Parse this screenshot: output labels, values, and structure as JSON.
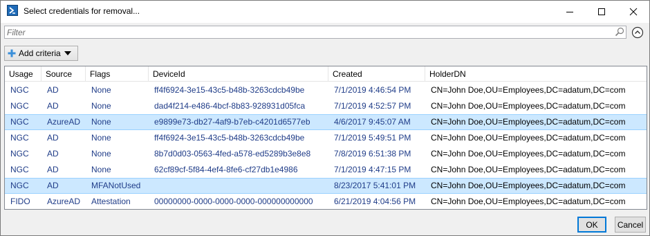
{
  "window": {
    "title": "Select credentials for removal...",
    "controls": [
      "minimize",
      "maximize",
      "close"
    ]
  },
  "filter": {
    "placeholder": "Filter",
    "value": ""
  },
  "toolbar": {
    "add_criteria_label": "Add criteria"
  },
  "grid": {
    "columns": [
      "Usage",
      "Source",
      "Flags",
      "DeviceId",
      "Created",
      "HolderDN"
    ],
    "rows": [
      {
        "usage": "NGC",
        "source": "AD",
        "flags": "None",
        "device_id": "ff4f6924-3e15-43c5-b48b-3263cdcb49be",
        "created": "7/1/2019 4:46:54 PM",
        "holder_dn": "CN=John Doe,OU=Employees,DC=adatum,DC=com",
        "selected": false
      },
      {
        "usage": "NGC",
        "source": "AD",
        "flags": "None",
        "device_id": "dad4f214-e486-4bcf-8b83-928931d05fca",
        "created": "7/1/2019 4:52:57 PM",
        "holder_dn": "CN=John Doe,OU=Employees,DC=adatum,DC=com",
        "selected": false
      },
      {
        "usage": "NGC",
        "source": "AzureAD",
        "flags": "None",
        "device_id": "e9899e73-db27-4af9-b7eb-c4201d6577eb",
        "created": "4/6/2017 9:45:07 AM",
        "holder_dn": "CN=John Doe,OU=Employees,DC=adatum,DC=com",
        "selected": true
      },
      {
        "usage": "NGC",
        "source": "AD",
        "flags": "None",
        "device_id": "ff4f6924-3e15-43c5-b48b-3263cdcb49be",
        "created": "7/1/2019 5:49:51 PM",
        "holder_dn": "CN=John Doe,OU=Employees,DC=adatum,DC=com",
        "selected": false
      },
      {
        "usage": "NGC",
        "source": "AD",
        "flags": "None",
        "device_id": "8b7d0d03-0563-4fed-a578-ed5289b3e8e8",
        "created": "7/8/2019 6:51:38 PM",
        "holder_dn": "CN=John Doe,OU=Employees,DC=adatum,DC=com",
        "selected": false
      },
      {
        "usage": "NGC",
        "source": "AD",
        "flags": "None",
        "device_id": "62cf89cf-5f84-4ef4-8fe6-cf27db1e4986",
        "created": "7/1/2019 4:47:15 PM",
        "holder_dn": "CN=John Doe,OU=Employees,DC=adatum,DC=com",
        "selected": false
      },
      {
        "usage": "NGC",
        "source": "AD",
        "flags": "MFANotUsed",
        "device_id": "",
        "created": "8/23/2017 5:41:01 PM",
        "holder_dn": "CN=John Doe,OU=Employees,DC=adatum,DC=com",
        "selected": true
      },
      {
        "usage": "FIDO",
        "source": "AzureAD",
        "flags": "Attestation",
        "device_id": "00000000-0000-0000-0000-000000000000",
        "created": "6/21/2019 4:04:56 PM",
        "holder_dn": "CN=John Doe,OU=Employees,DC=adatum,DC=com",
        "selected": false
      }
    ]
  },
  "buttons": {
    "ok_label": "OK",
    "cancel_label": "Cancel"
  },
  "colors": {
    "selection_bg": "#cce8ff",
    "selection_border": "#99d1ff",
    "cell_text": "#1f3c88",
    "default_button_border": "#0078d7"
  },
  "icons": {
    "app": "powershell-icon",
    "search": "search-icon",
    "collapse": "chevron-up-circle-icon",
    "add": "plus-icon",
    "dropdown": "caret-down-icon"
  }
}
